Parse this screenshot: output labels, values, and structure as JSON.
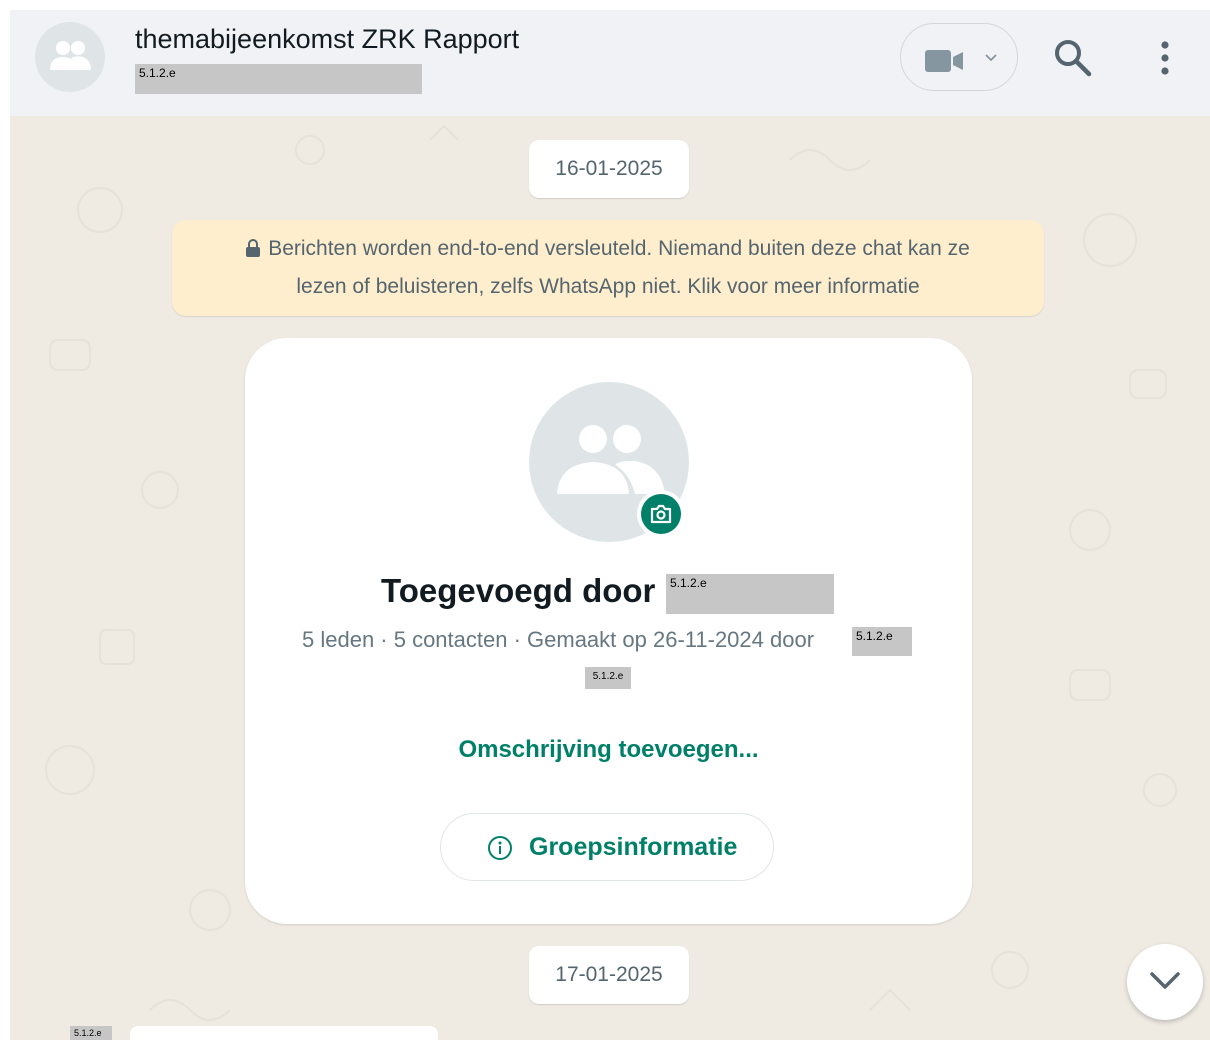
{
  "header": {
    "title": "themabijeenkomst ZRK Rapport",
    "subtitle_redaction": "5.1.2.e",
    "icons": {
      "avatar": "group-icon",
      "video": "video-call-icon",
      "dropdown": "chevron-down-icon",
      "search": "search-icon",
      "menu": "kebab-menu-icon"
    }
  },
  "chat": {
    "date_first": "16-01-2025",
    "encryption_notice_line1": "Berichten worden end-to-end versleuteld. Niemand buiten deze chat kan ze",
    "encryption_notice_line2": "lezen of beluisteren, zelfs WhatsApp niet. Klik voor meer informatie",
    "date_second": "17-01-2025",
    "bottom_redaction": "5.1.2.e"
  },
  "group_card": {
    "added_by_label": "Toegevoegd door",
    "added_by_redaction": "5.1.2.e",
    "meta": "5 leden · 5 contacten · Gemaakt op 26-11-2024 door",
    "meta_redaction": "5.1.2.e",
    "meta_redaction_2": "5.1.2.e",
    "add_description": "Omschrijving toevoegen...",
    "group_info_button": "Groepsinformatie"
  },
  "colors": {
    "accent": "#008069",
    "chat_background": "#efeae2",
    "notice_background": "#ffeecd",
    "header_background": "#f0f2f5"
  }
}
